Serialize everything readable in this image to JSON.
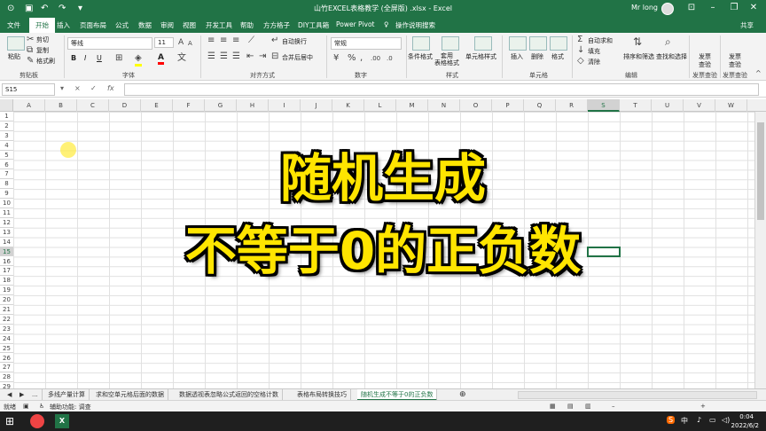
{
  "window": {
    "title": "山竹EXCEL表格教学 (全屏版) .xlsx - Excel",
    "user": "Mr long"
  },
  "tabs": [
    "文件",
    "开始",
    "插入",
    "页面布局",
    "公式",
    "数据",
    "审阅",
    "视图",
    "开发工具",
    "帮助",
    "方方格子",
    "DIY工具箱",
    "Power Pivot",
    "操作说明搜索"
  ],
  "active_tab": "开始",
  "share_label": "共享",
  "ribbon": {
    "clipboard": {
      "paste": "粘贴",
      "cut": "剪切",
      "copy": "复制",
      "format_painter": "格式刷",
      "label": "剪贴板"
    },
    "font": {
      "name": "等线",
      "size": "11",
      "bold": "B",
      "italic": "I",
      "underline": "U",
      "label": "字体",
      "font_color": "A",
      "fill_color": "#ffff00",
      "font_color_hex": "#ff0000"
    },
    "alignment": {
      "wrap": "自动换行",
      "merge": "合并后居中",
      "label": "对齐方式"
    },
    "number": {
      "format": "常规",
      "label": "数字"
    },
    "styles": {
      "conditional": "条件格式",
      "table": "套用\n表格格式",
      "cell_style": "单元格样式",
      "label": "样式"
    },
    "cells": {
      "insert": "插入",
      "delete": "删除",
      "format": "格式",
      "label": "单元格"
    },
    "editing": {
      "autosum": "自动求和",
      "fill": "填充",
      "clear": "清除",
      "sort": "排序和筛选",
      "find": "查找和选择",
      "label": "编辑"
    },
    "invoice1": {
      "top": "发票",
      "bottom": "查验",
      "label": "发票查验"
    },
    "invoice2": {
      "top": "发票",
      "bottom": "查验",
      "label": "发票查验"
    }
  },
  "formula_bar": {
    "cell_ref": "S15",
    "fx": "fx",
    "cancel": "×",
    "confirm": "✓",
    "value": ""
  },
  "columns": [
    "A",
    "B",
    "C",
    "D",
    "E",
    "F",
    "G",
    "H",
    "I",
    "J",
    "K",
    "L",
    "M",
    "N",
    "O",
    "P",
    "Q",
    "R",
    "S",
    "T",
    "U",
    "V",
    "W"
  ],
  "rows": [
    "1",
    "2",
    "3",
    "4",
    "5",
    "6",
    "7",
    "8",
    "9",
    "10",
    "11",
    "12",
    "13",
    "14",
    "15",
    "16",
    "17",
    "18",
    "19",
    "20",
    "21",
    "22",
    "23",
    "24",
    "25",
    "26",
    "27",
    "28",
    "29"
  ],
  "selected_cell": {
    "col": "S",
    "row": "15"
  },
  "caption": {
    "line1": "随机生成",
    "line2": "不等于0的正负数",
    "color": "#ffe500"
  },
  "sheets": [
    "...",
    "多线产量计算",
    "求和空单元格后面的数据",
    "数据透视表忽略公式返回的空格计数",
    "表格布局转换技巧",
    "随机生成不等于0的正负数"
  ],
  "active_sheet": "随机生成不等于0的正负数",
  "status": {
    "ready": "就绪",
    "accessibility": "辅助功能: 调查"
  },
  "taskbar": {
    "time": "0:04",
    "date": "2022/6/2",
    "ime": "中",
    "tray_icons": [
      "中",
      "英"
    ]
  },
  "colors": {
    "accent": "#217346",
    "caption": "#ffe500"
  }
}
